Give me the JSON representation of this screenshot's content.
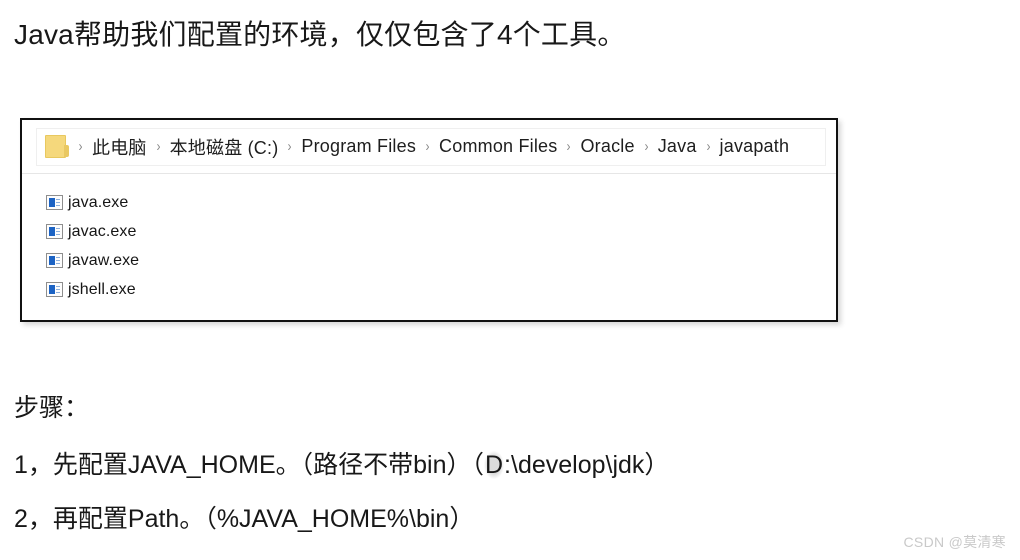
{
  "slide": {
    "heading": "Java帮助我们配置的环境，仅仅包含了4个工具。"
  },
  "explorer": {
    "folder_icon_name": "folder-icon",
    "breadcrumb_separator": "›",
    "breadcrumbs": [
      {
        "label": "此电脑"
      },
      {
        "label": "本地磁盘 (C:)"
      },
      {
        "label": "Program Files"
      },
      {
        "label": "Common Files"
      },
      {
        "label": "Oracle"
      },
      {
        "label": "Java"
      },
      {
        "label": "javapath"
      }
    ],
    "files": [
      {
        "name": "java.exe"
      },
      {
        "name": "javac.exe"
      },
      {
        "name": "javaw.exe"
      },
      {
        "name": "jshell.exe"
      }
    ]
  },
  "steps": {
    "title": "步骤：",
    "items": [
      {
        "prefix": "1，先配置JAVA_HOME。（路径不带bin）（",
        "highlight": "D",
        "suffix": ":\\develop\\jdk）"
      },
      {
        "prefix": "2，再配置Path。（%JAVA_HOME%\\bin）",
        "highlight": "",
        "suffix": ""
      }
    ]
  },
  "watermark": {
    "text": "CSDN @莫清寒"
  },
  "colors": {
    "panel_border": "#111111",
    "folder_yellow": "#f5d87c",
    "file_icon_blue": "#1c63c4",
    "text": "#181818",
    "watermark": "#c9c9c9"
  }
}
